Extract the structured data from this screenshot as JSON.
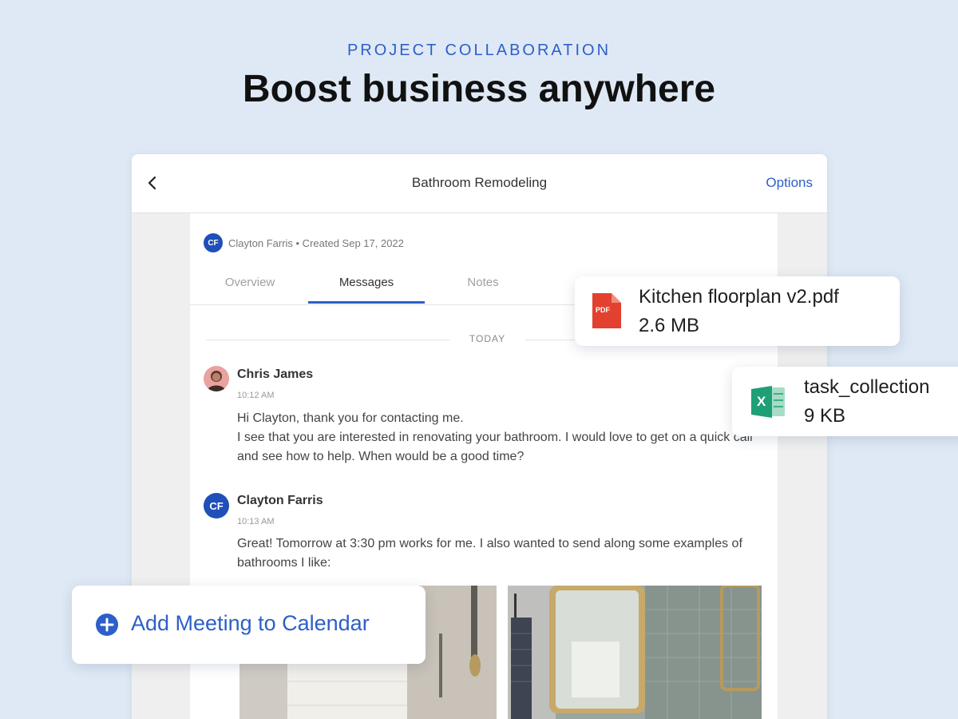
{
  "hero": {
    "eyebrow": "PROJECT COLLABORATION",
    "headline": "Boost business anywhere"
  },
  "topbar": {
    "title": "Bathroom Remodeling",
    "options_label": "Options",
    "back_icon": "chevron-left-icon"
  },
  "project_meta": {
    "avatar_initials": "CF",
    "text": "Clayton Farris • Created Sep 17, 2022"
  },
  "tabs": [
    {
      "label": "Overview",
      "active": false
    },
    {
      "label": "Messages",
      "active": true
    },
    {
      "label": "Notes",
      "active": false
    }
  ],
  "date_divider": "TODAY",
  "messages": [
    {
      "author": "Chris James",
      "time": "10:12 AM",
      "lines": [
        "Hi Clayton, thank you for contacting me.",
        "I see that you are interested in renovating your bathroom. I would love to get on a quick call and see how to help. When would be a good time?"
      ]
    },
    {
      "author": "Clayton Farris",
      "avatar_initials": "CF",
      "time": "10:13 AM",
      "lines": [
        "Great! Tomorrow at 3:30 pm works for me. I also wanted to send along some examples of bathrooms I like:"
      ]
    }
  ],
  "files": [
    {
      "name": "Kitchen floorplan v2.pdf",
      "size": "2.6 MB",
      "icon": "pdf-file-icon",
      "icon_label": "PDF",
      "color": "#e2412f"
    },
    {
      "name": "task_collection",
      "size": "9 KB",
      "icon": "excel-file-icon",
      "icon_label": "X",
      "color": "#1f9f75"
    }
  ],
  "cta": {
    "label": "Add Meeting to Calendar",
    "icon": "plus-circle-icon"
  },
  "colors": {
    "accent": "#2d5fc8",
    "background": "#dfe9f5",
    "avatar": "#1f4fb8"
  }
}
